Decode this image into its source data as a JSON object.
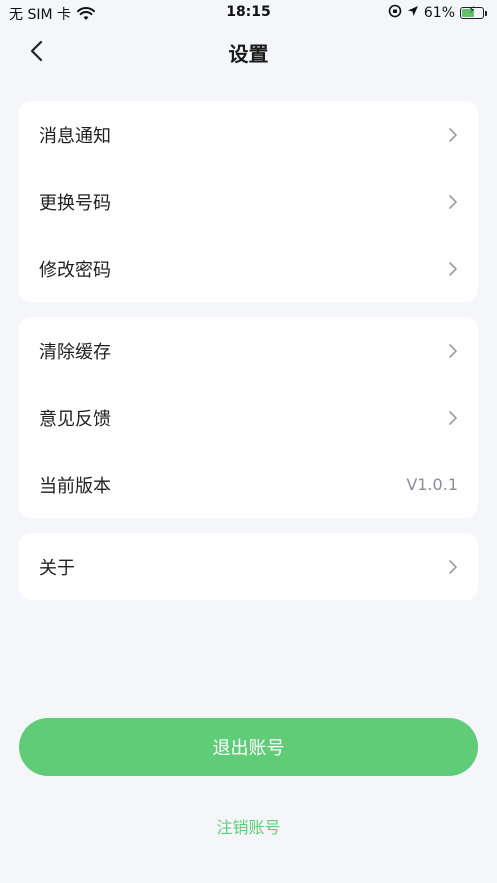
{
  "status_bar": {
    "carrier": "无 SIM 卡",
    "time": "18:15",
    "battery_percent": "61%",
    "battery_level": 0.61,
    "battery_color": "#5ec46a"
  },
  "header": {
    "title": "设置",
    "back_icon": "chevron-left-icon"
  },
  "groups": [
    {
      "items": [
        {
          "label": "消息通知"
        },
        {
          "label": "更换号码"
        },
        {
          "label": "修改密码"
        }
      ]
    },
    {
      "items": [
        {
          "label": "清除缓存"
        },
        {
          "label": "意见反馈"
        },
        {
          "label": "当前版本",
          "value": "V1.0.1"
        }
      ]
    },
    {
      "items": [
        {
          "label": "关于"
        }
      ]
    }
  ],
  "actions": {
    "logout_label": "退出账号",
    "cancel_account_label": "注销账号"
  },
  "colors": {
    "accent": "#60cc78",
    "background": "#f5f6fa",
    "card": "#ffffff"
  }
}
